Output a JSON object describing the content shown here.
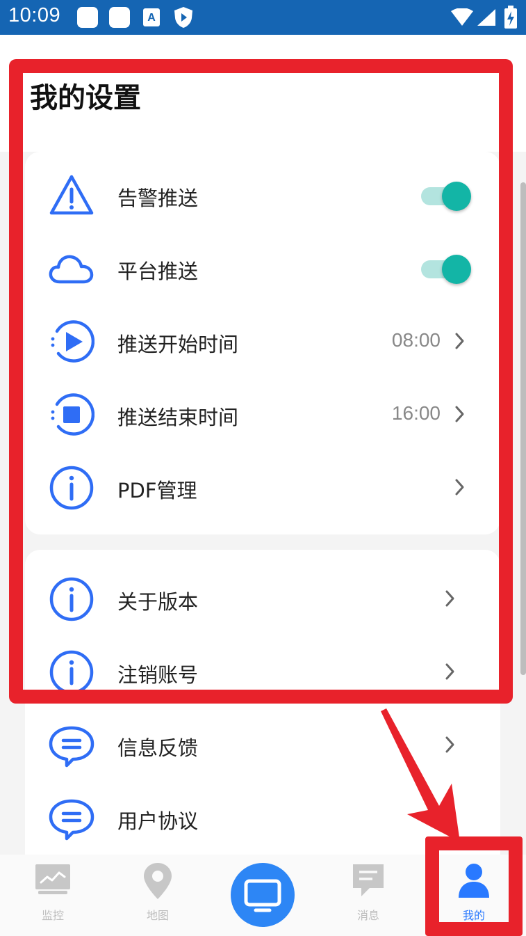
{
  "status_bar": {
    "time": "10:09",
    "background": "#1565b3",
    "left_icons": [
      "app-icon",
      "app-icon",
      "a-icon",
      "shield-icon"
    ],
    "right_icons": [
      "wifi-icon",
      "signal-icon",
      "battery-charging-icon"
    ]
  },
  "page": {
    "title": "我的设置"
  },
  "settings": {
    "group1": [
      {
        "icon": "warning-icon",
        "label": "告警推送",
        "type": "toggle",
        "on": true
      },
      {
        "icon": "cloud-icon",
        "label": "平台推送",
        "type": "toggle",
        "on": true
      },
      {
        "icon": "play-icon",
        "label": "推送开始时间",
        "value": "08:00",
        "type": "link"
      },
      {
        "icon": "stop-icon",
        "label": "推送结束时间",
        "value": "16:00",
        "type": "link"
      },
      {
        "icon": "info-icon",
        "label": "PDF管理",
        "type": "link"
      }
    ],
    "group2": [
      {
        "icon": "info-icon",
        "label": "关于版本",
        "type": "link"
      },
      {
        "icon": "info-icon",
        "label": "注销账号",
        "type": "link"
      },
      {
        "icon": "chat-icon",
        "label": "信息反馈",
        "type": "link"
      },
      {
        "icon": "chat-icon",
        "label": "用户协议",
        "type": "link"
      }
    ]
  },
  "bottom_nav": {
    "tabs": [
      {
        "label": "监控",
        "icon": "monitor-chart-icon",
        "active": false
      },
      {
        "label": "地图",
        "icon": "map-pin-icon",
        "active": false
      },
      {
        "label": "",
        "icon": "tv-icon",
        "active": false
      },
      {
        "label": "消息",
        "icon": "message-icon",
        "active": false
      },
      {
        "label": "我的",
        "icon": "person-icon",
        "active": true
      }
    ]
  },
  "colors": {
    "accent": "#2979ff",
    "toggle_on": "#13b5a6",
    "annotation_red": "#e8222b",
    "icon_blue": "#2f6df5"
  }
}
